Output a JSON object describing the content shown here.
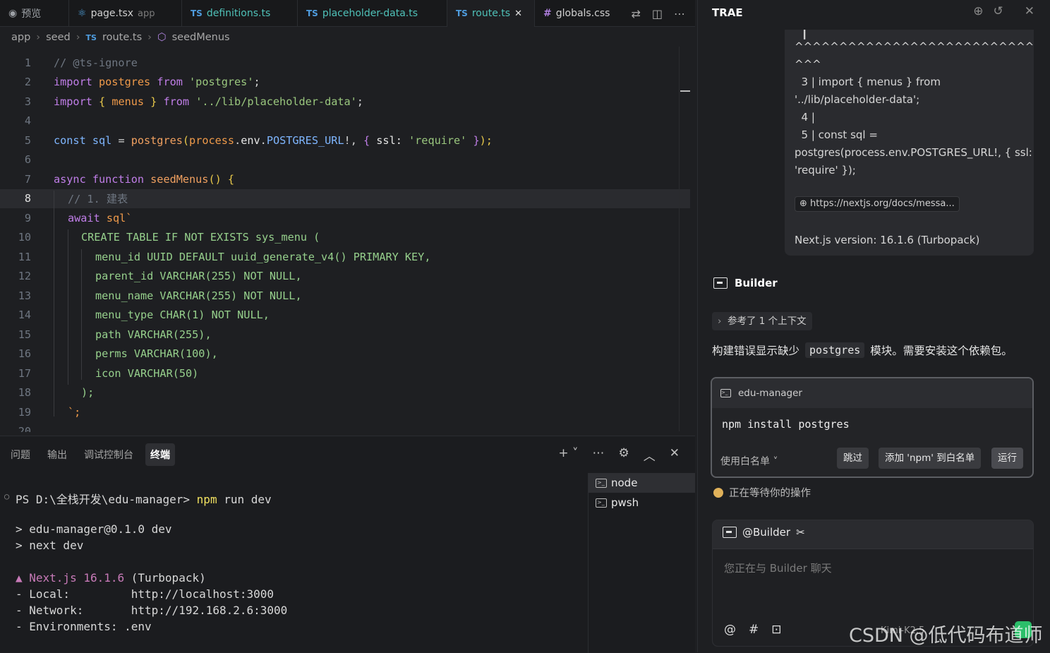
{
  "tabs": [
    {
      "prefix": "",
      "label": "预览",
      "suffix": ""
    },
    {
      "prefix": "",
      "label": "page.tsx",
      "suffix": "app"
    },
    {
      "prefix": "TS",
      "label": "definitions.ts",
      "suffix": ""
    },
    {
      "prefix": "TS",
      "label": "placeholder-data.ts",
      "suffix": ""
    },
    {
      "prefix": "TS",
      "label": "route.ts",
      "suffix": "✕"
    },
    {
      "prefix": "#",
      "label": "globals.css",
      "suffix": ""
    }
  ],
  "breadcrumb": {
    "a": "app",
    "b": "seed",
    "c_prefix": "TS",
    "c": "route.ts",
    "d": "seedMenus"
  },
  "code_lines": [
    {
      "n": "1"
    },
    {
      "n": "2"
    },
    {
      "n": "3"
    },
    {
      "n": "4"
    },
    {
      "n": "5"
    },
    {
      "n": "6"
    },
    {
      "n": "7"
    },
    {
      "n": "8"
    },
    {
      "n": "9"
    },
    {
      "n": "10"
    },
    {
      "n": "11"
    },
    {
      "n": "12"
    },
    {
      "n": "13"
    },
    {
      "n": "14"
    },
    {
      "n": "15"
    },
    {
      "n": "16"
    },
    {
      "n": "17"
    },
    {
      "n": "18"
    },
    {
      "n": "19"
    },
    {
      "n": "20"
    }
  ],
  "code": {
    "l1": "// @ts-ignore",
    "l2a": "import",
    "l2b": " postgres ",
    "l2c": "from",
    "l2d": " 'postgres'",
    "l2e": ";",
    "l3a": "import",
    "l3b": " { ",
    "l3c": "menus",
    "l3d": " } ",
    "l3e": "from",
    "l3f": " '../lib/placeholder-data'",
    "l3g": ";",
    "l5a": "const",
    "l5b": " sql ",
    "l5c": "= ",
    "l5d": "postgres",
    "l5e": "(",
    "l5f": "process",
    "l5g": ".",
    "l5h": "env",
    ".": ".",
    "l5i": "POSTGRES_URL",
    "l5j": "!, ",
    "l5k": "{",
    "l5l": " ssl: ",
    "l5m": "'require'",
    "l5n": " }",
    "l5o": ");",
    "l7a": "async",
    "l7b": " function ",
    "l7c": "seedMenus",
    "l7d": "() ",
    "l7e": "{",
    "l8": "// 1. 建表",
    "l9a": "await",
    "l9b": " sql`",
    "l10": "CREATE TABLE IF NOT EXISTS sys_menu (",
    "l11": "menu_id UUID DEFAULT uuid_generate_v4() PRIMARY KEY,",
    "l12": "parent_id VARCHAR(255) NOT NULL,",
    "l13": "menu_name VARCHAR(255) NOT NULL,",
    "l14": "menu_type CHAR(1) NOT NULL,",
    "l15": "path VARCHAR(255),",
    "l16": "perms VARCHAR(100),",
    "l17": "icon VARCHAR(50)",
    "l18": ");",
    "l19": "`;"
  },
  "panel": {
    "tabs": [
      "问题",
      "输出",
      "调试控制台",
      "终端"
    ],
    "terminal_lines": [
      "PS D:\\全栈开发\\edu-manager> ",
      "npm",
      " run dev",
      "> edu-manager@0.1.0 dev",
      "> next dev",
      "▲ Next.js 16.1.6",
      " (Turbopack)",
      "- Local:         http://localhost:3000",
      "- Network:       http://192.168.2.6:3000",
      "- Environments: .env"
    ],
    "term_list": [
      "node",
      "pwsh"
    ]
  },
  "trae": {
    "title": "TRAE",
    "err_lines": [
      "^^^^^^^^^^^^^^^^^^^^^^^^^^^^^",
      "^^^",
      "  3 | import { menus } from",
      "'../lib/placeholder-data';",
      "  4 |",
      "  5 | const sql =",
      "postgres(process.env.POSTGRES_URL!, { ssl:",
      "'require' });"
    ],
    "link": "https://nextjs.org/docs/messa...",
    "version": "Next.js version: 16.1.6 (Turbopack)",
    "builder": "Builder",
    "ctx": "参考了 1 个上下文",
    "msg_a": "构建错误显示缺少",
    "msg_code": "postgres",
    "msg_b": "模块。需要安装这个依赖包。",
    "cmd_project": "edu-manager",
    "cmd": "npm install postgres",
    "whitelist": "使用白名单",
    "skip": "跳过",
    "add": "添加 'npm' 到白名单",
    "run": "运行",
    "waiting": "正在等待你的操作",
    "chat_at": "@Builder",
    "chat_ph": "您正在与 Builder 聊天",
    "model": "Kimi-K2.5",
    "tools": [
      "@",
      "#"
    ]
  },
  "watermark": "CSDN @低代码布道师"
}
